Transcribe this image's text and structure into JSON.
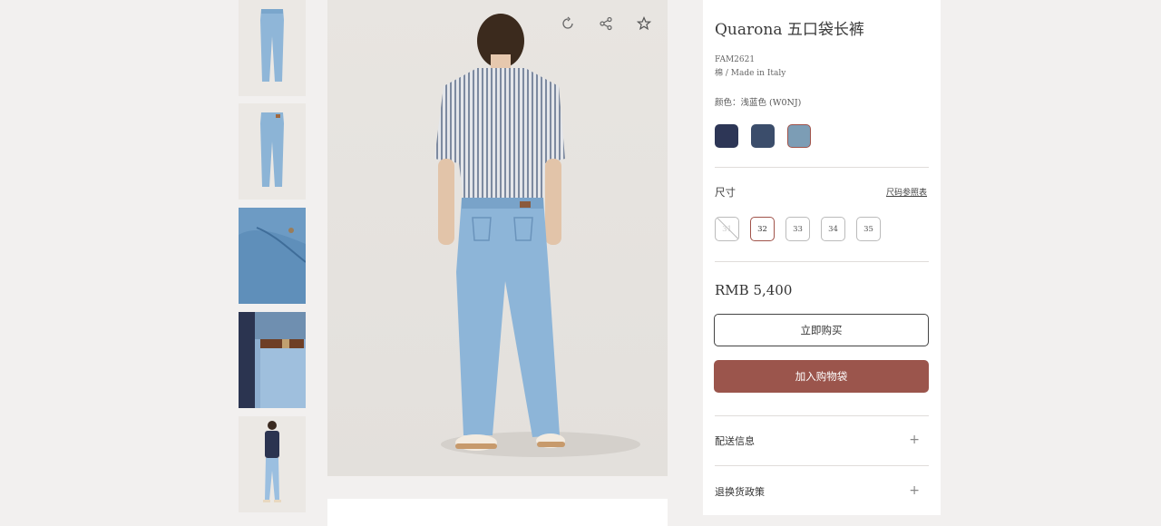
{
  "thumbnails": [
    {
      "name": "jeans-front",
      "label": ""
    },
    {
      "name": "jeans-back",
      "label": ""
    },
    {
      "name": "fabric-detail",
      "label": ""
    },
    {
      "name": "belt-detail",
      "label": ""
    },
    {
      "name": "model-full",
      "label": ""
    }
  ],
  "image_actions": {
    "icons": [
      "rotate-360-icon",
      "share-icon",
      "favorite-star-icon"
    ]
  },
  "product": {
    "title": "Quarona 五口袋长裤",
    "sku": "FAM2621",
    "material": "棉 / Made in Italy",
    "color_label": "颜色：浅蓝色 (W0NJ)",
    "swatch_colors": [
      "#2d3656",
      "#3b4d6b",
      "#7c9db5"
    ],
    "size_label": "尺寸",
    "size_guide": "尺码参照表",
    "sizes": [
      "31",
      "32",
      "33",
      "34",
      "35"
    ],
    "selected_size": "32",
    "unavailable_size": "31",
    "price": "RMB 5,400",
    "buy_now": "立即购买",
    "add_to_bag": "加入购物袋"
  },
  "accordions": [
    {
      "label": "配送信息",
      "icon": "+"
    },
    {
      "label": "退换货政策",
      "icon": "+"
    }
  ],
  "colors": {
    "accent": "#9b554c",
    "page_bg": "#f2f0ef"
  }
}
